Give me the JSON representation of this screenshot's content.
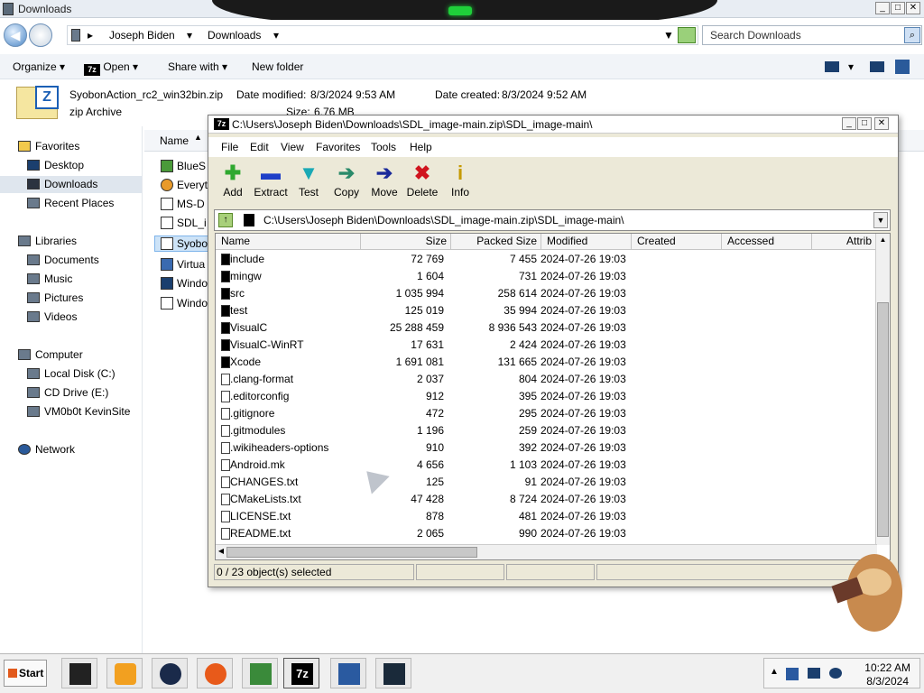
{
  "explorer": {
    "title": "Downloads",
    "breadcrumb": [
      "Joseph Biden",
      "Downloads"
    ],
    "search_placeholder": "Search Downloads",
    "commands": [
      "Organize",
      "Open",
      "Share with",
      "New folder"
    ],
    "details": {
      "filename": "SyobonAction_rc2_win32bin.zip",
      "type": "zip Archive",
      "modified_label": "Date modified:",
      "modified": "8/3/2024 9:53 AM",
      "created_label": "Date created:",
      "created": "8/3/2024 9:52 AM",
      "size_label": "Size:",
      "size": "6.76 MB"
    },
    "sidebar": {
      "favorites": "Favorites",
      "favorites_items": [
        "Desktop",
        "Downloads",
        "Recent Places"
      ],
      "libraries": "Libraries",
      "libraries_items": [
        "Documents",
        "Music",
        "Pictures",
        "Videos"
      ],
      "computer": "Computer",
      "computer_items": [
        "Local Disk (C:)",
        "CD Drive (E:)",
        "VM0b0t KevinSite"
      ],
      "network": "Network"
    },
    "column_name": "Name",
    "files": [
      "BlueS",
      "Everyt",
      "MS-D",
      "SDL_i",
      "Syobo",
      "Virtua",
      "Windo",
      "Windo"
    ]
  },
  "zip": {
    "title": "C:\\Users\\Joseph Biden\\Downloads\\SDL_image-main.zip\\SDL_image-main\\",
    "menu": [
      "File",
      "Edit",
      "View",
      "Favorites",
      "Tools",
      "Help"
    ],
    "toolbar": [
      {
        "label": "Add",
        "icon": "add-icon",
        "glyph": "✚",
        "color": "#2fa82f"
      },
      {
        "label": "Extract",
        "icon": "extract-icon",
        "glyph": "▬",
        "color": "#1e3fc8"
      },
      {
        "label": "Test",
        "icon": "test-icon",
        "glyph": "▼",
        "color": "#1aa9b5"
      },
      {
        "label": "Copy",
        "icon": "copy-icon",
        "glyph": "➔",
        "color": "#2a8a6a"
      },
      {
        "label": "Move",
        "icon": "move-icon",
        "glyph": "➔",
        "color": "#1a2a9a"
      },
      {
        "label": "Delete",
        "icon": "delete-icon",
        "glyph": "✖",
        "color": "#d0141e"
      },
      {
        "label": "Info",
        "icon": "info-icon",
        "glyph": "i",
        "color": "#c59a00"
      }
    ],
    "path": "C:\\Users\\Joseph Biden\\Downloads\\SDL_image-main.zip\\SDL_image-main\\",
    "columns": [
      "Name",
      "Size",
      "Packed Size",
      "Modified",
      "Created",
      "Accessed",
      "Attrib"
    ],
    "rows": [
      {
        "name": "include",
        "size": "72 769",
        "packed": "7 455",
        "modified": "2024-07-26 19:03",
        "folder": true
      },
      {
        "name": "mingw",
        "size": "1 604",
        "packed": "731",
        "modified": "2024-07-26 19:03",
        "folder": true
      },
      {
        "name": "src",
        "size": "1 035 994",
        "packed": "258 614",
        "modified": "2024-07-26 19:03",
        "folder": true
      },
      {
        "name": "test",
        "size": "125 019",
        "packed": "35 994",
        "modified": "2024-07-26 19:03",
        "folder": true
      },
      {
        "name": "VisualC",
        "size": "25 288 459",
        "packed": "8 936 543",
        "modified": "2024-07-26 19:03",
        "folder": true
      },
      {
        "name": "VisualC-WinRT",
        "size": "17 631",
        "packed": "2 424",
        "modified": "2024-07-26 19:03",
        "folder": true
      },
      {
        "name": "Xcode",
        "size": "1 691 081",
        "packed": "131 665",
        "modified": "2024-07-26 19:03",
        "folder": true
      },
      {
        "name": ".clang-format",
        "size": "2 037",
        "packed": "804",
        "modified": "2024-07-26 19:03",
        "folder": false
      },
      {
        "name": ".editorconfig",
        "size": "912",
        "packed": "395",
        "modified": "2024-07-26 19:03",
        "folder": false
      },
      {
        "name": ".gitignore",
        "size": "472",
        "packed": "295",
        "modified": "2024-07-26 19:03",
        "folder": false
      },
      {
        "name": ".gitmodules",
        "size": "1 196",
        "packed": "259",
        "modified": "2024-07-26 19:03",
        "folder": false
      },
      {
        "name": ".wikiheaders-options",
        "size": "910",
        "packed": "392",
        "modified": "2024-07-26 19:03",
        "folder": false
      },
      {
        "name": "Android.mk",
        "size": "4 656",
        "packed": "1 103",
        "modified": "2024-07-26 19:03",
        "folder": false
      },
      {
        "name": "CHANGES.txt",
        "size": "125",
        "packed": "91",
        "modified": "2024-07-26 19:03",
        "folder": false
      },
      {
        "name": "CMakeLists.txt",
        "size": "47 428",
        "packed": "8 724",
        "modified": "2024-07-26 19:03",
        "folder": false
      },
      {
        "name": "LICENSE.txt",
        "size": "878",
        "packed": "481",
        "modified": "2024-07-26 19:03",
        "folder": false
      },
      {
        "name": "README.txt",
        "size": "2 065",
        "packed": "990",
        "modified": "2024-07-26 19:03",
        "folder": false
      }
    ],
    "status": "0 / 23 object(s) selected"
  },
  "taskbar": {
    "start": "Start",
    "time": "10:22 AM",
    "date": "8/3/2024"
  }
}
